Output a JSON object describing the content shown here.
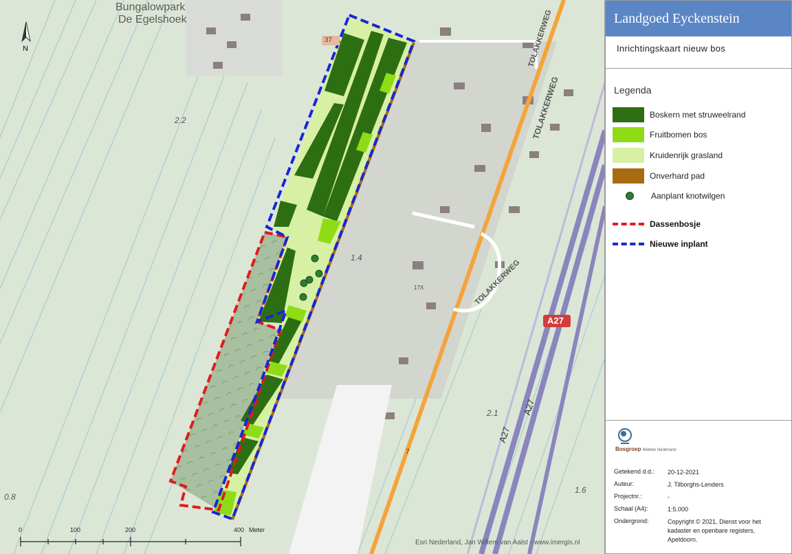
{
  "panel": {
    "title": "Landgoed Eyckenstein",
    "subtitle": "Inrichtingskaart nieuw bos",
    "legend_title": "Legenda",
    "legend_items": [
      {
        "label": "Boskern met struweelrand",
        "color": "#2e6e12"
      },
      {
        "label": "Fruitbomen bos",
        "color": "#8fdc16"
      },
      {
        "label": "Kruidenrijk grasland",
        "color": "#d7f0a4"
      },
      {
        "label": "Onverhard pad",
        "color": "#a86b12"
      },
      {
        "label": "Aanplant knotwilgen",
        "color": "#2e7d32"
      }
    ],
    "boundaries": [
      {
        "label": "Dassenbosje",
        "color": "#e01b1b"
      },
      {
        "label": "Nieuwe inplant",
        "color": "#1826d6"
      }
    ],
    "logo_text": "Bosgroep",
    "logo_sub": "Midden Nederland",
    "meta": [
      {
        "key": "Getekend d.d.:",
        "value": "20-12-2021"
      },
      {
        "key": "Auteur:",
        "value": "J. Tilborghs-Lenders"
      },
      {
        "key": "Projectnr.:",
        "value": "-"
      },
      {
        "key": "Schaal (A4):",
        "value": "1:5.000"
      },
      {
        "key": "Ondergrond:",
        "value": "Copyright © 2021, Dienst voor het kadaster en openbare registers, Apeldoorn."
      }
    ]
  },
  "map": {
    "labels": {
      "park": "Bungalowpark",
      "park2": "De Egelshoek",
      "north": "N",
      "road1": "TOLAKKERWEG",
      "road2": "TOLAKKERWEG",
      "road3": "TOLAKKERWEG",
      "motorway_sign": "A27",
      "motorway1": "A27",
      "motorway2": "A27",
      "elev1": "2.2",
      "elev2": "1.4",
      "elev3": "2.1",
      "elev4": "1.6",
      "elev5": "0.8",
      "route_no": "37",
      "house_no": "7",
      "poi": "17X"
    },
    "attribution": "Esri Nederland, Jan Willem van Aalst - www.imergis.nl",
    "scale": {
      "ticks": [
        "0",
        "100",
        "200",
        "400"
      ],
      "unit": "Meter"
    }
  }
}
